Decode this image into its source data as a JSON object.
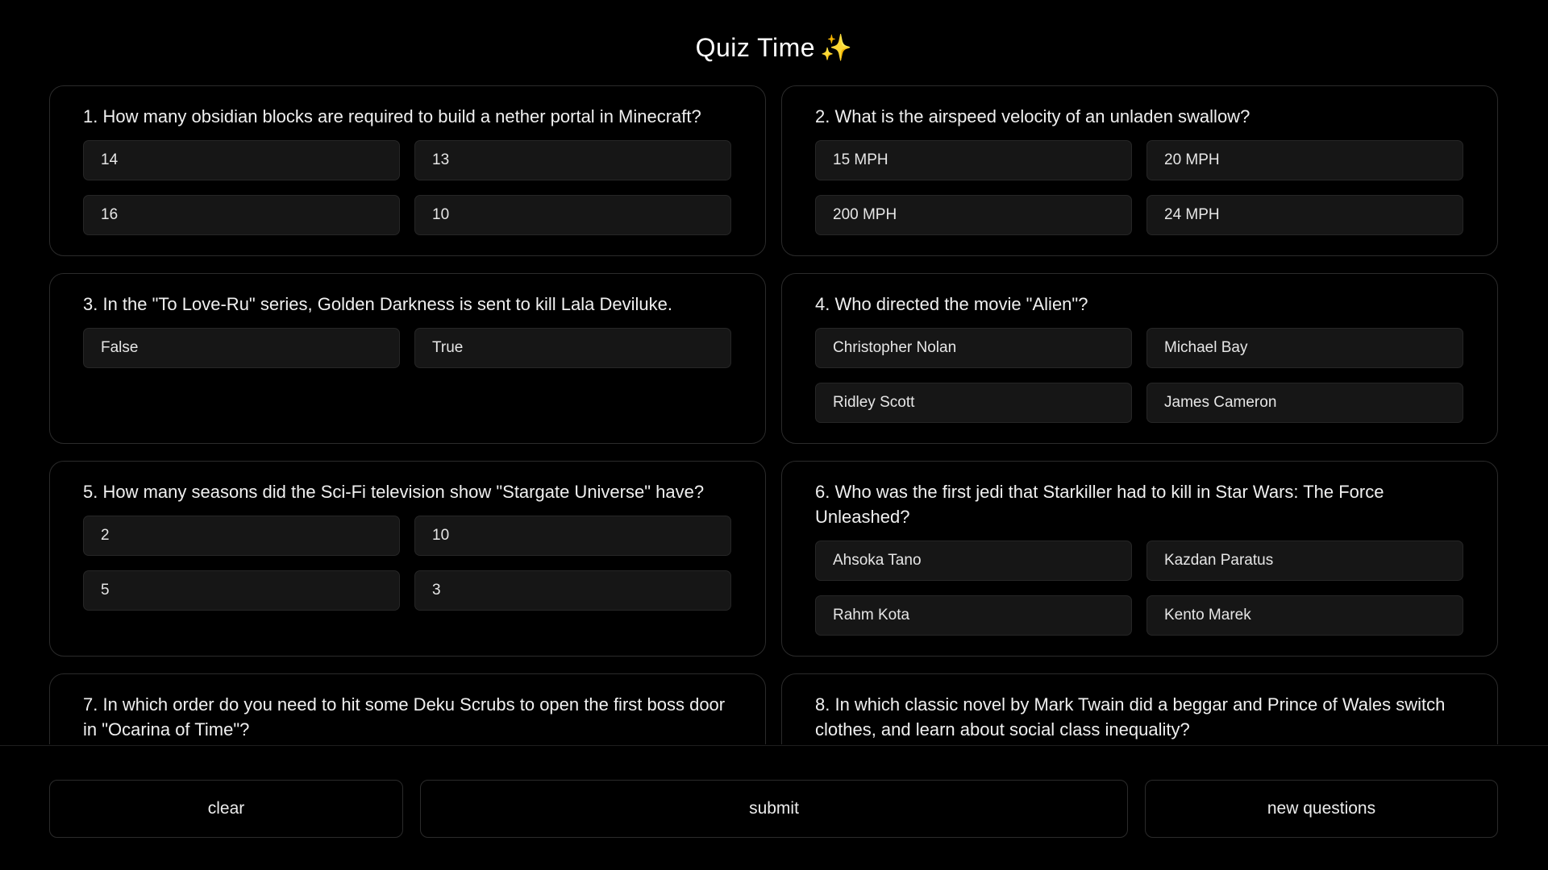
{
  "header": {
    "title": "Quiz Time",
    "title_icon": "✨"
  },
  "questions": [
    {
      "text": "1. How many obsidian blocks are required to build a nether portal in Minecraft?",
      "answers": [
        "14",
        "13",
        "16",
        "10"
      ]
    },
    {
      "text": "2. What is the airspeed velocity of an unladen swallow?",
      "answers": [
        "15 MPH",
        "20 MPH",
        "200 MPH",
        "24 MPH"
      ]
    },
    {
      "text": "3. In the \"To Love-Ru\" series, Golden Darkness is sent to kill Lala Deviluke.",
      "answers": [
        "False",
        "True"
      ]
    },
    {
      "text": "4. Who directed the movie \"Alien\"?",
      "answers": [
        "Christopher Nolan",
        "Michael Bay",
        "Ridley Scott",
        "James Cameron"
      ]
    },
    {
      "text": "5. How many seasons did the Sci-Fi television show \"Stargate Universe\" have?",
      "answers": [
        "2",
        "10",
        "5",
        "3"
      ]
    },
    {
      "text": "6. Who was the first jedi that Starkiller had to kill in Star Wars: The Force Unleashed?",
      "answers": [
        "Ahsoka Tano",
        "Kazdan Paratus",
        "Rahm Kota",
        "Kento Marek"
      ]
    },
    {
      "text": "7. In which order do you need to hit some Deku Scrubs to open the first boss door in \"Ocarina of Time\"?",
      "answers": []
    },
    {
      "text": "8. In which classic novel by Mark Twain did a beggar and Prince of Wales switch clothes, and learn about social class inequality?",
      "answers": []
    }
  ],
  "footer": {
    "clear_label": "clear",
    "submit_label": "submit",
    "new_questions_label": "new questions"
  },
  "colors": {
    "background": "#000000",
    "card_border": "#2b2b2b",
    "answer_bg": "#161616",
    "text": "#f0f0f0"
  }
}
